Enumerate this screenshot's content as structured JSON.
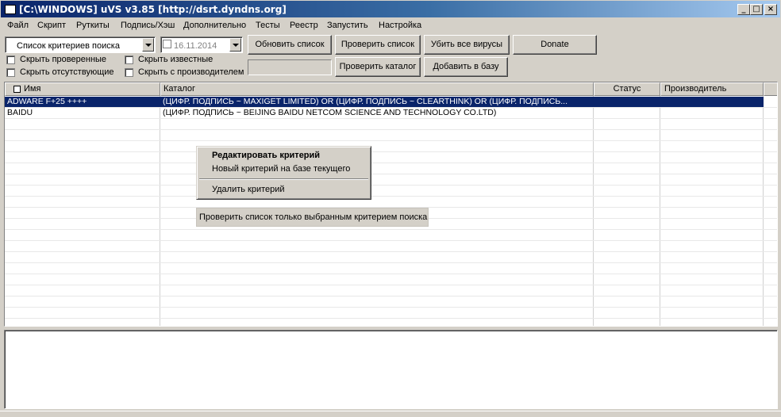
{
  "window": {
    "title": "[C:\\WINDOWS] uVS v3.85 [http://dsrt.dyndns.org]"
  },
  "menu": [
    "Файл",
    "Скрипт",
    "Руткиты",
    "Подпись/Хэш",
    "Дополнительно",
    "Тесты",
    "Реестр",
    "Запустить",
    "Настройка"
  ],
  "toolbar": {
    "criteria_combo": "Список критериев поиска",
    "date_combo": "16.11.2014",
    "btn_refresh": "Обновить список",
    "btn_check_list": "Проверить список",
    "btn_kill_viruses": "Убить все вирусы",
    "btn_donate": "Donate",
    "btn_check_catalog": "Проверить каталог",
    "btn_add_db": "Добавить в базу",
    "cb_hide_checked": "Скрыть проверенные",
    "cb_hide_known": "Скрыть известные",
    "cb_hide_missing": "Скрыть отсутствующие",
    "cb_hide_vendor": "Скрыть с производителем"
  },
  "grid": {
    "columns": {
      "name": "Имя",
      "catalog": "Каталог",
      "status": "Статус",
      "vendor": "Производитель"
    },
    "rows": [
      {
        "name": "ADWARE F+25 ++++",
        "catalog": "(ЦИФР. ПОДПИСЬ ~ MAXIGET LIMITED)   OR   (ЦИФР. ПОДПИСЬ ~ CLEARTHINK)   OR   (ЦИФР. ПОДПИСЬ...",
        "status": "",
        "vendor": ""
      },
      {
        "name": "BAIDU",
        "catalog": "(ЦИФР. ПОДПИСЬ ~ BEIJING BAIDU NETCOM SCIENCE AND TECHNOLOGY CO.LTD)",
        "status": "",
        "vendor": ""
      }
    ]
  },
  "context_menu": {
    "edit": "Редактировать критерий",
    "new_based": "Новый критерий на базе текущего",
    "delete": "Удалить критерий"
  },
  "tooltip": "Проверить список только выбранным критерием поиска"
}
